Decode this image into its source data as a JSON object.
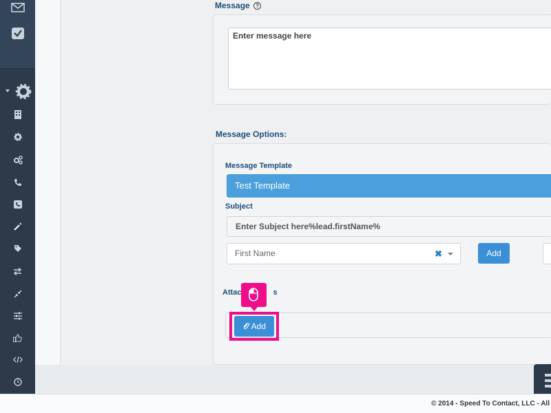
{
  "sidebar": {
    "icons": [
      "envelope-icon",
      "calendar-check-icon",
      "settings-gear-icon",
      "building-icon",
      "cog-icon",
      "cogs-icon",
      "phone-icon",
      "phone-square-icon",
      "magic-wand-icon",
      "tag-icon",
      "exchange-icon",
      "compress-icon",
      "sliders-icon",
      "thumbs-up-icon",
      "code-icon",
      "clock-icon"
    ]
  },
  "message": {
    "label": "Message",
    "help_icon": "?",
    "placeholder": "Enter message here"
  },
  "options": {
    "heading": "Message Options:",
    "template_label": "Message Template",
    "template_value": "Test Template",
    "subject_label": "Subject",
    "subject_value": "Enter Subject here%lead.firstName%",
    "field_select_value": "First Name",
    "add_button": "Add",
    "attachments_label": "Attac",
    "attachments_label_tail": "s",
    "attach_button": "Add"
  },
  "footer": {
    "text": "© 2014 - Speed To Contact, LLC - All"
  },
  "colors": {
    "sidebar": "#2c3a4a",
    "accent": "#4a9fdc",
    "highlight": "#ee0d8a"
  }
}
